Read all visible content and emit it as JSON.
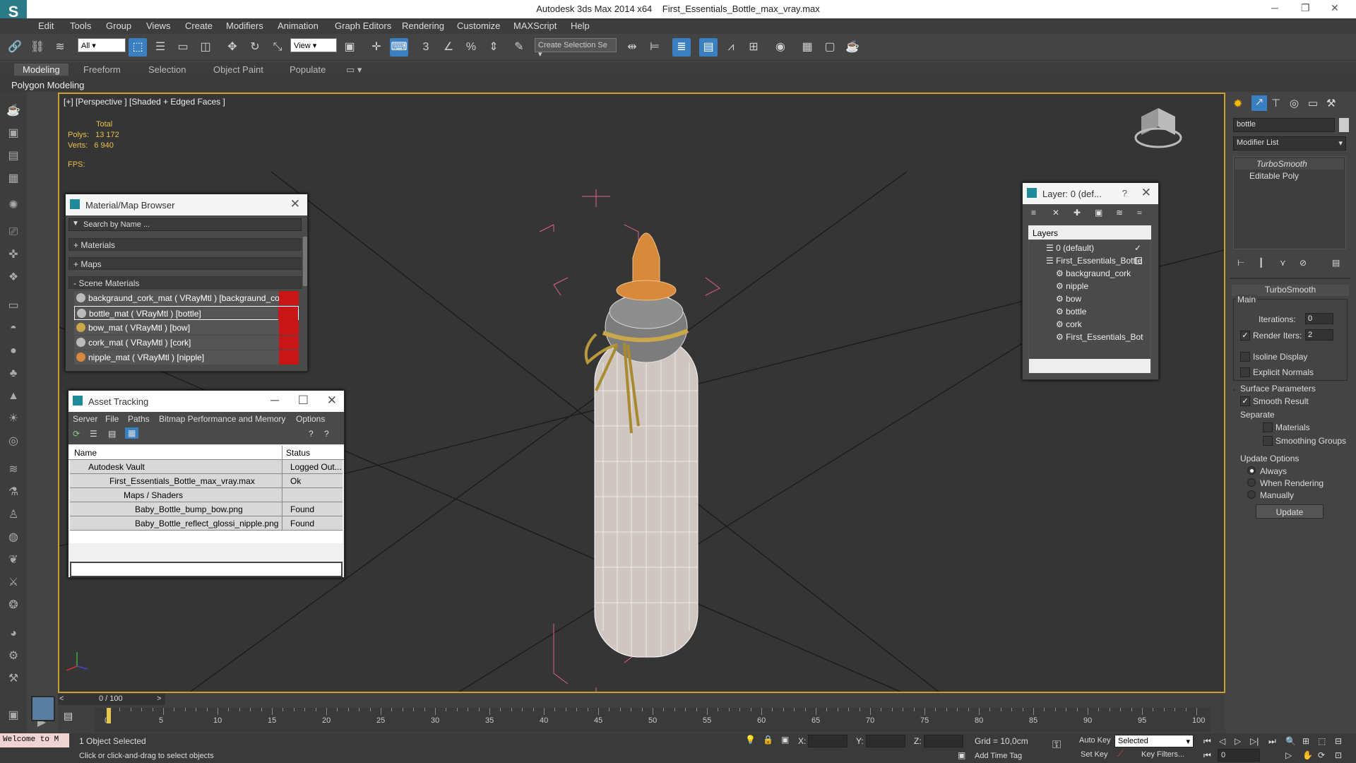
{
  "titlebar": {
    "app": "Autodesk 3ds Max  2014 x64",
    "file": "First_Essentials_Bottle_max_vray.max"
  },
  "menu": [
    "Edit",
    "Tools",
    "Group",
    "Views",
    "Create",
    "Modifiers",
    "Animation",
    "Graph Editors",
    "Rendering",
    "Customize",
    "MAXScript",
    "Help"
  ],
  "toolbar": {
    "filter_select": "All",
    "refcoord_select": "View",
    "selection_set_placeholder": "Create Selection Se"
  },
  "ribbon": {
    "tabs": [
      "Modeling",
      "Freeform",
      "Selection",
      "Object Paint",
      "Populate"
    ],
    "active": "Modeling",
    "sub": "Polygon Modeling"
  },
  "viewport": {
    "label": "[+] [Perspective ] [Shaded + Edged Faces ]",
    "total_label": "Total",
    "polys_label": "Polys:",
    "polys_value": "13 172",
    "verts_label": "Verts:",
    "verts_value": "6 940",
    "fps_label": "FPS:"
  },
  "material_browser": {
    "title": "Material/Map Browser",
    "search_placeholder": "Search by Name ...",
    "cat_materials": "+ Materials",
    "cat_maps": "+ Maps",
    "cat_scene": "- Scene Materials",
    "materials": [
      "backgraund_cork_mat  ( VRayMtl )  [backgraund_cork]",
      "bottle_mat  ( VRayMtl )  [bottle]",
      "bow_mat  ( VRayMtl )  [bow]",
      "cork_mat  ( VRayMtl )  [cork]",
      "nipple_mat  ( VRayMtl )  [nipple]"
    ]
  },
  "asset_tracking": {
    "title": "Asset Tracking",
    "menu": [
      "Server",
      "File",
      "Paths",
      "Bitmap Performance and Memory",
      "Options"
    ],
    "col_name": "Name",
    "col_status": "Status",
    "rows": [
      {
        "name": "Autodesk Vault",
        "status": "Logged Out..."
      },
      {
        "name": "First_Essentials_Bottle_max_vray.max",
        "status": "Ok"
      },
      {
        "name": "Maps / Shaders",
        "status": ""
      },
      {
        "name": "Baby_Bottle_bump_bow.png",
        "status": "Found"
      },
      {
        "name": "Baby_Bottle_reflect_glossi_nipple.png",
        "status": "Found"
      }
    ]
  },
  "layer_dialog": {
    "title": "Layer: 0 (def...",
    "help": "?",
    "header": "Layers",
    "items": [
      "0 (default)",
      "First_Essentials_Bottle",
      "backgraund_cork",
      "nipple",
      "bow",
      "bottle",
      "cork",
      "First_Essentials_Bot"
    ]
  },
  "command_panel": {
    "object_name": "bottle",
    "modifier_list": "Modifier List",
    "stack": [
      "TurboSmooth",
      "Editable Poly"
    ],
    "rollout_title": "TurboSmooth",
    "main_label": "Main",
    "iterations_label": "Iterations:",
    "iterations_value": "0",
    "render_iters_label": "Render Iters:",
    "render_iters_value": "2",
    "isoline": "Isoline Display",
    "explicit_normals": "Explicit Normals",
    "surface_params": "Surface Parameters",
    "smooth_result": "Smooth Result",
    "separate": "Separate",
    "materials": "Materials",
    "smoothing_groups": "Smoothing Groups",
    "update_options": "Update Options",
    "always": "Always",
    "when_rendering": "When Rendering",
    "manually": "Manually",
    "update_btn": "Update"
  },
  "timeline": {
    "frame": "0 / 100",
    "ticks": [
      "0",
      "5",
      "10",
      "15",
      "20",
      "25",
      "30",
      "35",
      "40",
      "45",
      "50",
      "55",
      "60",
      "65",
      "70",
      "75",
      "80",
      "85",
      "90",
      "95",
      "100"
    ]
  },
  "status": {
    "welcome": "Welcome to M",
    "selected": "1 Object Selected",
    "prompt": "Click or click-and-drag to select objects",
    "x_label": "X:",
    "y_label": "Y:",
    "z_label": "Z:",
    "grid": "Grid = 10,0cm",
    "add_time_tag": "Add Time Tag",
    "auto_key": "Auto Key",
    "set_key": "Set Key",
    "selected_dropdown": "Selected",
    "key_filters": "Key Filters...",
    "frame_value": "0"
  }
}
